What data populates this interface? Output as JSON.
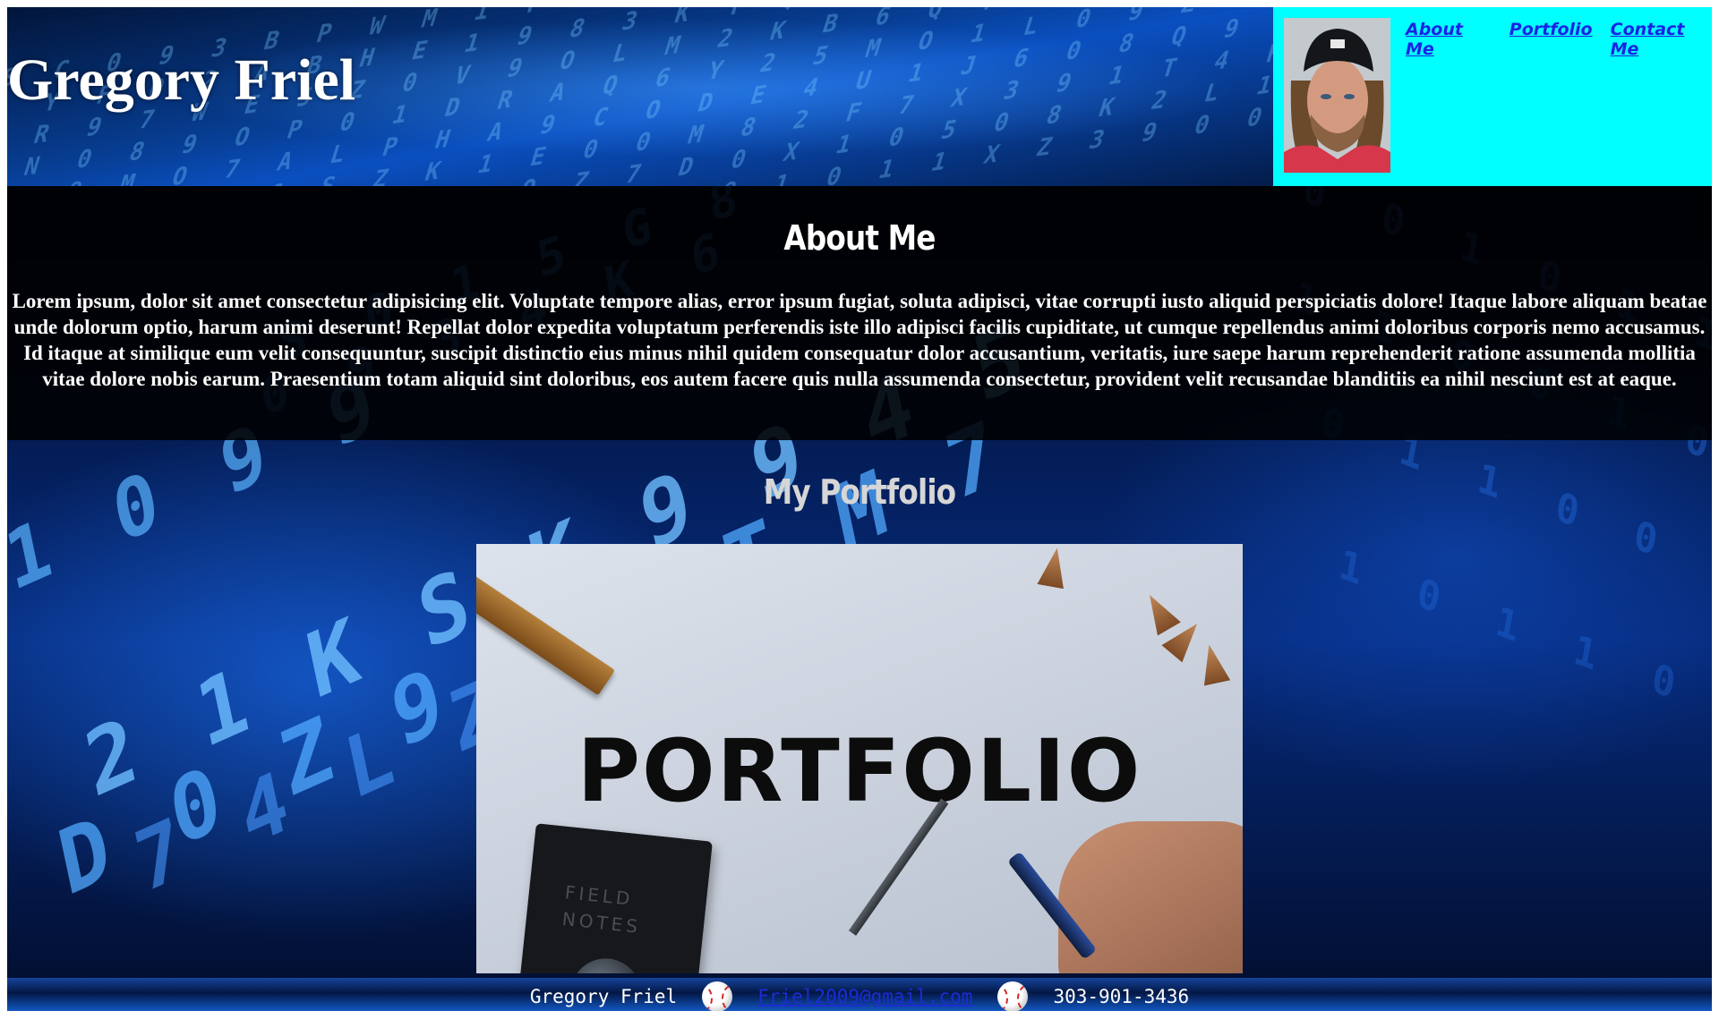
{
  "header": {
    "site_title": "Gregory Friel",
    "nav": [
      {
        "label": "About Me"
      },
      {
        "label": "Portfolio"
      },
      {
        "label": "Contact Me"
      }
    ]
  },
  "about": {
    "heading": "About Me",
    "body": "Lorem ipsum, dolor sit amet consectetur adipisicing elit. Voluptate tempore alias, error ipsum fugiat, soluta adipisci, vitae corrupti iusto aliquid perspiciatis dolore! Itaque labore aliquam beatae unde dolorum optio, harum animi deserunt! Repellat dolor expedita voluptatum perferendis iste illo adipisci facilis cupiditate, ut cumque repellendus animi doloribus corporis nemo accusamus. Id itaque at similique eum velit consequuntur, suscipit distinctio eius minus nihil quidem consequatur dolor accusantium, veritatis, iure saepe harum reprehenderit ratione assumenda mollitia vitae dolore nobis earum. Praesentium totam aliquid sint doloribus, eos autem facere quis nulla assumenda consectetur, provident velit recusandae blanditiis ea nihil nesciunt est at eaque."
  },
  "portfolio": {
    "heading": "My Portfolio",
    "image_text": "PORTFOLIO",
    "notebook_text": "FIELD NOTES"
  },
  "footer": {
    "name": "Gregory Friel",
    "email": "Friel2009@gmail.com",
    "phone": "303-901-3436"
  },
  "colors": {
    "nav_panel_bg": "#00ffff",
    "nav_link": "#1a24e6",
    "email_link": "#1d2bd6"
  }
}
